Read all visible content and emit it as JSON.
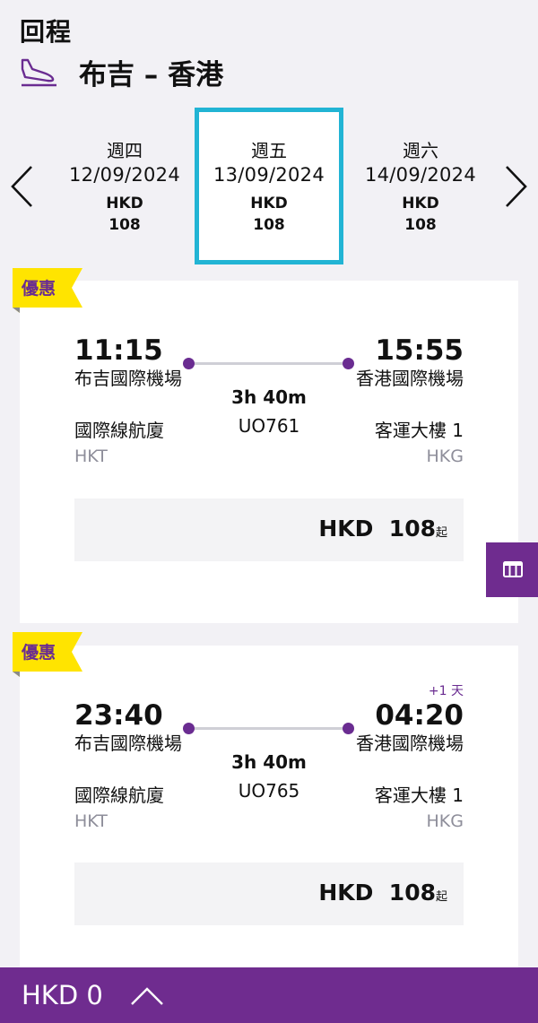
{
  "header": {
    "subtitle": "回程",
    "route": "布吉 – 香港",
    "plane_icon": "plane-landing-icon"
  },
  "date_nav": {
    "dates": [
      {
        "dow": "週四",
        "date": "12/09/2024",
        "currency": "HKD",
        "price": "108"
      },
      {
        "dow": "週五",
        "date": "13/09/2024",
        "currency": "HKD",
        "price": "108",
        "selected": true
      },
      {
        "dow": "週六",
        "date": "14/09/2024",
        "currency": "HKD",
        "price": "108"
      }
    ]
  },
  "flights": [
    {
      "badge": "優惠",
      "depart_time": "11:15",
      "depart_airport": "布吉國際機場",
      "depart_terminal": "國際線航廈",
      "depart_code": "HKT",
      "arrive_time": "15:55",
      "arrive_airport": "香港國際機場",
      "arrive_terminal": "客運大樓 1",
      "arrive_code": "HKG",
      "duration": "3h 40m",
      "flight_no": "UO761",
      "next_day": "",
      "price_currency": "HKD",
      "price_amount": "108",
      "price_suffix": "起"
    },
    {
      "badge": "優惠",
      "depart_time": "23:40",
      "depart_airport": "布吉國際機場",
      "depart_terminal": "國際線航廈",
      "depart_code": "HKT",
      "arrive_time": "04:20",
      "arrive_airport": "香港國際機場",
      "arrive_terminal": "客運大樓 1",
      "arrive_code": "HKG",
      "duration": "3h 40m",
      "flight_no": "UO765",
      "next_day": "+1 天",
      "price_currency": "HKD",
      "price_amount": "108",
      "price_suffix": "起"
    }
  ],
  "bottom_bar": {
    "total": "HKD 0"
  },
  "colors": {
    "brand_purple": "#6f2c8f",
    "accent_cyan": "#22b4d4",
    "badge_yellow": "#ffe400",
    "background": "#f2f1f5"
  }
}
